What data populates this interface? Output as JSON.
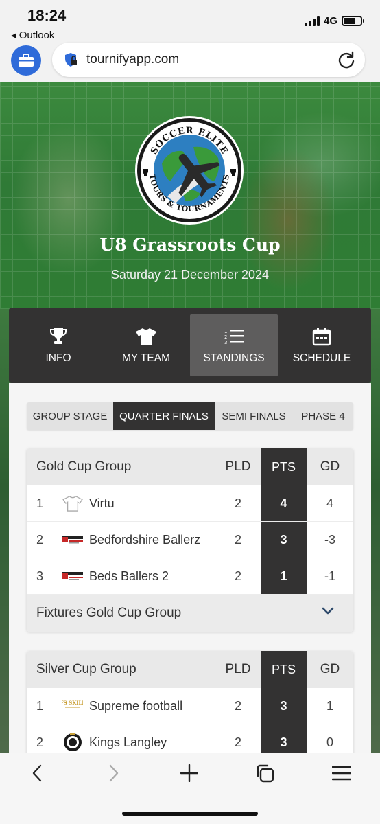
{
  "status_bar": {
    "time": "18:24",
    "back_app": "◂ Outlook",
    "network": "4G",
    "battery_level": 0.7
  },
  "browser": {
    "url": "tournifyapp.com"
  },
  "hero": {
    "logo_top_text": "SOCCER ELITE",
    "logo_bottom_text": "TOURS & TOURNAMENTS",
    "title": "U8 Grassroots Cup",
    "date": "Saturday 21 December 2024"
  },
  "nav": [
    {
      "label": "INFO",
      "icon": "trophy-icon",
      "active": false
    },
    {
      "label": "MY TEAM",
      "icon": "shirt-icon",
      "active": false
    },
    {
      "label": "STANDINGS",
      "icon": "ranked-list-icon",
      "active": true
    },
    {
      "label": "SCHEDULE",
      "icon": "calendar-icon",
      "active": false
    }
  ],
  "phase_tabs": [
    {
      "label": "GROUP STAGE",
      "active": false
    },
    {
      "label": "QUARTER FINALS",
      "active": true
    },
    {
      "label": "SEMI FINALS",
      "active": false
    },
    {
      "label": "PHASE 4",
      "active": false
    }
  ],
  "columns": {
    "pld": "PLD",
    "pts": "PTS",
    "gd": "GD"
  },
  "groups": [
    {
      "name": "Gold Cup Group",
      "rows": [
        {
          "rank": "1",
          "team": "Virtu",
          "crest": "shirt-outline",
          "pld": "2",
          "pts": "4",
          "gd": "4"
        },
        {
          "rank": "2",
          "team": "Bedfordshire Ballerz",
          "crest": "bedfordshire-ballerz-crest",
          "pld": "2",
          "pts": "3",
          "gd": "-3"
        },
        {
          "rank": "3",
          "team": "Beds Ballers 2",
          "crest": "bedfordshire-ballerz-crest",
          "pld": "2",
          "pts": "1",
          "gd": "-1"
        }
      ],
      "fixtures_label": "Fixtures Gold Cup Group"
    },
    {
      "name": "Silver Cup Group",
      "rows": [
        {
          "rank": "1",
          "team": "Supreme football",
          "crest": "sfs-skills-crest",
          "pld": "2",
          "pts": "3",
          "gd": "1"
        },
        {
          "rank": "2",
          "team": "Kings Langley",
          "crest": "kings-langley-crest",
          "pld": "2",
          "pts": "3",
          "gd": "0"
        }
      ]
    }
  ],
  "crest_texts": {
    "sfs_skills": "SFS SKILLS"
  },
  "colors": {
    "nav_dark": "#333232",
    "nav_active": "#5e5d5d",
    "accent_blue": "#2f6bd9",
    "chevron": "#2e4a6b"
  }
}
